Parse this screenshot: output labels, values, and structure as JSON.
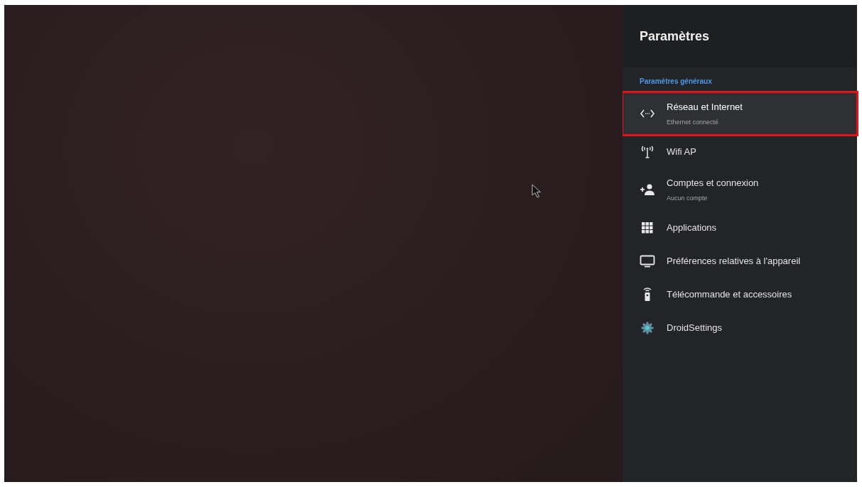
{
  "panel": {
    "title": "Paramètres",
    "section": "Paramètres généraux",
    "items": [
      {
        "label": "Réseau et Internet",
        "sublabel": "Ethernet connecté",
        "selected": true,
        "highlighted": true
      },
      {
        "label": "Wifi AP",
        "selected": false,
        "highlighted": false
      },
      {
        "label": "Comptes et connexion",
        "sublabel": "Aucun compte",
        "selected": false,
        "highlighted": false
      },
      {
        "label": "Applications",
        "selected": false,
        "highlighted": false
      },
      {
        "label": "Préférences relatives à l'appareil",
        "selected": false,
        "highlighted": false
      },
      {
        "label": "Télécommande et accessoires",
        "selected": false,
        "highlighted": false
      },
      {
        "label": "DroidSettings",
        "selected": false,
        "highlighted": false
      }
    ]
  }
}
